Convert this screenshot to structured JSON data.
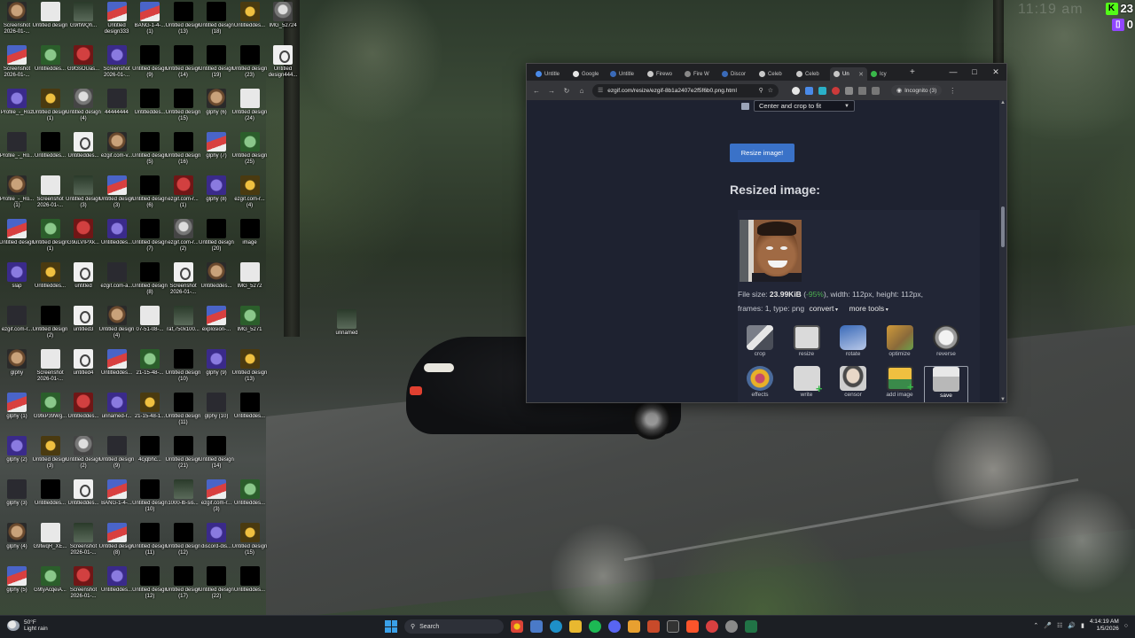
{
  "overlay": {
    "kick_count": "23",
    "twitch_count": "0",
    "kick_icon": "kick-icon",
    "twitch_icon": "twitch-icon"
  },
  "wallpaper_clock": "11:19 am",
  "desktop_icons": [
    [
      "Screenshot 2026-01-...",
      "Untitled design",
      "G9rtWQh...",
      "Untitled design333",
      "BANG-1-4-... (1)",
      "Untitled design (13)",
      "Untitled design (18)",
      "Untitleddes...",
      "IMG_52724"
    ],
    [
      "Screenshot 2026-01-...",
      "Untitleddes...",
      "G9t3sOUas...",
      "Screenshot 2026-01-...",
      "Untitled design (9)",
      "Untitled design (14)",
      "Untitled design (19)",
      "Untitled design (23)",
      "Untitled design444..."
    ],
    [
      "Profile_-_Roz",
      "Untitled design (1)",
      "Untitled design (4)",
      "44444444",
      "Untitleddes...",
      "Untitled design (15)",
      "glphy (6)",
      "Untitled design (24)"
    ],
    [
      "Profile_-_Ro...",
      "Untitleddes...",
      "Untitleddes...",
      "ezgif.com-v...",
      "Untitled design (5)",
      "Untitled design (16)",
      "glphy (7)",
      "Untitled design (25)"
    ],
    [
      "Profile_-_Ro... (1)",
      "Screenshot 2026-01-...",
      "Untitled design (3)",
      "Untitled design (3)",
      "Untitled design (6)",
      "ezgif.com-r... (1)",
      "glphy (8)",
      "ezgif.com-r... (4)"
    ],
    [
      "Untitled design",
      "Untitled design (1)",
      "G9uLVIPXk...",
      "Untitleddes...",
      "Untitled design (7)",
      "ezgif.com-r... (2)",
      "Untitled design (20)",
      "image"
    ],
    [
      "slap",
      "Untitleddes...",
      "untitled",
      "ezgif.com-a...",
      "Untitled design (8)",
      "Screenshot 2026-01-...",
      "Untitleddes...",
      "IMG_5272"
    ],
    [
      "ezgif.com-r...",
      "Untitled design (2)",
      "untitled3",
      "Untitled design (4)",
      "07-51-08-...",
      "raf,750x100...",
      "explosion-...",
      "IMG_5271"
    ],
    [
      "glphy",
      "Screenshot 2026-01-...",
      "untitled4",
      "Untitleddes...",
      "21-15-48-...",
      "Untitled design (10)",
      "glphy (9)",
      "Untitled design (13)"
    ],
    [
      "glphy (1)",
      "G9tkP39Wg...",
      "Untitleddes...",
      "unnamed-r...",
      "21-15-48-1...",
      "Untitled design (11)",
      "glphy (10)",
      "Untitleddes..."
    ],
    [
      "glphy (2)",
      "Untitled design (3)",
      "Untitled design (2)",
      "Untitled design (9)",
      "4cjqbhc...",
      "Untitled design (21)",
      "Untitled design (14)"
    ],
    [
      "glphy (3)",
      "Untitleddes...",
      "Untitleddes...",
      "BANG-1-4-...",
      "Untitled design (10)",
      "1000-lb-sis...",
      "ezgif.com-r... (3)",
      "Untitleddes..."
    ],
    [
      "glphy (4)",
      "G9twqR_XE...",
      "Screenshot 2026-01-...",
      "Untitled design (8)",
      "Untitled design (11)",
      "Untitled design (12)",
      "discord-dis...",
      "Untitled design (15)"
    ],
    [
      "glphy (5)",
      "G9tyAcqeiA...",
      "Screenshot 2026-01-...",
      "Untitleddes...",
      "Untitled design (12)",
      "Untitled design (17)",
      "Untitled design (22)",
      "Untitleddes..."
    ]
  ],
  "loose_icon": "unnamed",
  "browser": {
    "tabs": [
      "Untitle",
      "Google",
      "Untitle",
      "Firewo",
      "Fire W",
      "Discor",
      "Celeb",
      "Celeb",
      "Un",
      "Icy"
    ],
    "url": "ezgif.com/resize/ezgif-8b1a2407e2f5f6b0.png.html",
    "incognito": "Incognito (3)",
    "page": {
      "crop_option": "Center and crop to fit",
      "resize_button": "Resize image!",
      "heading": "Resized image:",
      "file_size_label": "File size: ",
      "file_size": "23.99KiB",
      "pct_open": " (",
      "percent": "-95%",
      "pct_close": ")",
      "dims": ", width: 112px, height: 112px,",
      "frames": "frames: 1, type: png",
      "convert": "convert",
      "more_tools": "more tools",
      "tools_row1": [
        "crop",
        "resize",
        "rotate",
        "optimize",
        "reverse"
      ],
      "tools_row2": [
        "effects",
        "write",
        "censor",
        "add image",
        "save"
      ]
    }
  },
  "taskbar": {
    "weather_temp": "50°F",
    "weather_desc": "Light rain",
    "search_placeholder": "Search",
    "time": "4:14:19 AM",
    "date": "1/5/2026"
  }
}
